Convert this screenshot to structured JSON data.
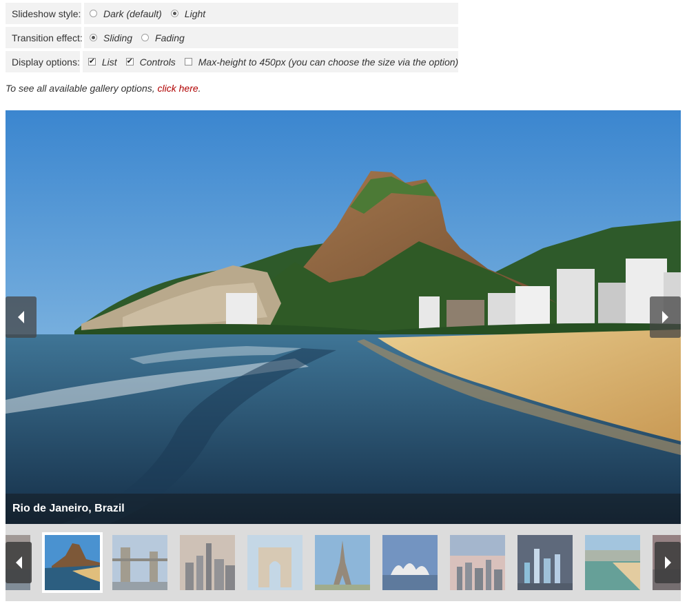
{
  "options": {
    "style": {
      "label": "Slideshow style:",
      "choices": [
        "Dark (default)",
        "Light"
      ],
      "selected": "Light"
    },
    "transition": {
      "label": "Transition effect:",
      "choices": [
        "Sliding",
        "Fading"
      ],
      "selected": "Sliding"
    },
    "display": {
      "label": "Display options:",
      "list": {
        "label": "List",
        "checked": true
      },
      "controls": {
        "label": "Controls",
        "checked": true
      },
      "maxheight": {
        "label": "Max-height to 450px (you can choose the size via the option)",
        "checked": false
      }
    }
  },
  "info": {
    "text": "To see all available gallery options, ",
    "link": "click here",
    "end": "."
  },
  "slide": {
    "caption": "Rio de Janeiro, Brazil"
  },
  "thumbnails": [
    {
      "id": "partial-left",
      "active": false
    },
    {
      "id": "rio",
      "active": true
    },
    {
      "id": "london-bridge",
      "active": false
    },
    {
      "id": "new-york",
      "active": false
    },
    {
      "id": "india-gate",
      "active": false
    },
    {
      "id": "eiffel-tower",
      "active": false
    },
    {
      "id": "sydney-opera",
      "active": false
    },
    {
      "id": "city-skyline",
      "active": false
    },
    {
      "id": "night-skyline",
      "active": false
    },
    {
      "id": "coastal-beach",
      "active": false
    },
    {
      "id": "partial-right",
      "active": false
    }
  ],
  "colors": {
    "sky": "#4f97d4",
    "sea": "#2d5c7d",
    "sand": "#e3c27e",
    "mountain": "#8a5f3c",
    "link": "#b00000"
  }
}
